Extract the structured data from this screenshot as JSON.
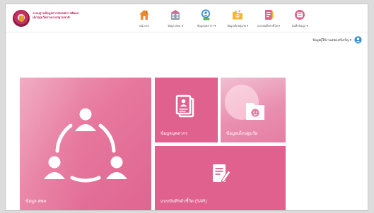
{
  "header": {
    "brand_line1": "ระบบฐานข้อมูลสารสนเทศการพัฒนา",
    "brand_line2": "เด็กปฐมวัยตามมาตรฐานชาติ",
    "logo": "institution-seal",
    "accent_color": "#c0305e"
  },
  "nav": {
    "items": [
      {
        "label": "หน้าแรก",
        "icon": "home-icon",
        "color": "#e98b2c"
      },
      {
        "label": "ข้อมูล สพด. ▾",
        "icon": "daycare-table-icon",
        "color": "#6f7f94"
      },
      {
        "label": "ข้อมูลบุคลากร ▾",
        "icon": "people-search-icon",
        "color": "#3d8fd3"
      },
      {
        "label": "ข้อมูลเด็กปฐมวัย ▾",
        "icon": "child-folder-icon",
        "color": "#f0b72f"
      },
      {
        "label": "แบบบันทึกตัวชี้วัด ▾",
        "icon": "report-book-icon",
        "color": "#e0608e"
      },
      {
        "label": "บันทึกข้อมูล ▾",
        "icon": "record-disc-icon",
        "color": "#e0608e"
      }
    ]
  },
  "user": {
    "label": "ข้อมูลผู้ใช้งานสพด.ศรีเจริญ ▾",
    "icon": "user-circle-icon",
    "color": "#3d8fd3"
  },
  "tiles": {
    "daycare_label": "ข้อมูล สพด.",
    "personnel_label": "ข้อมูลบุคลากร",
    "children_label": "ข้อมูลเด็กปฐมวัย",
    "sar_label": "แบบบันทึกตัวชี้วัด (SAR)",
    "tile_color": "#e0608e"
  }
}
